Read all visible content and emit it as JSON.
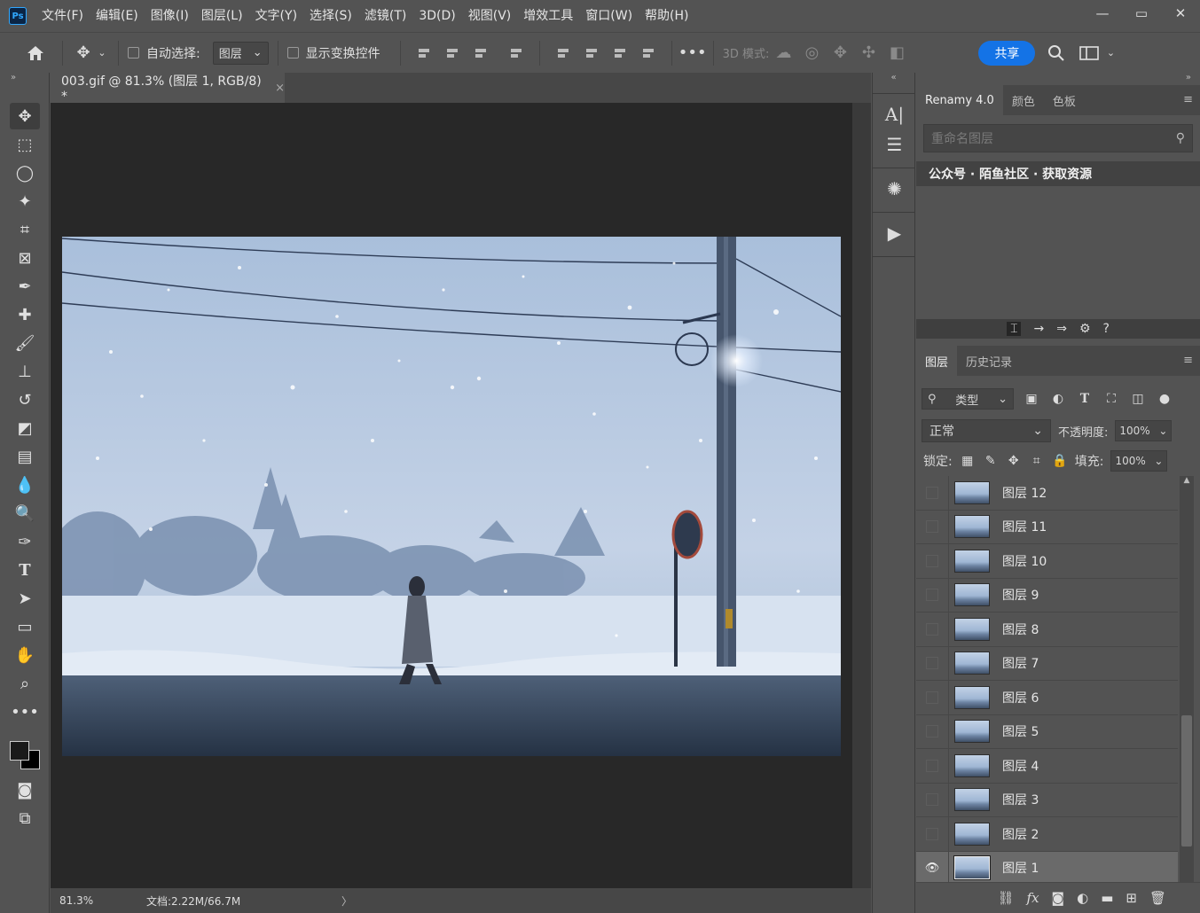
{
  "menu": {
    "logo": "Ps",
    "items": [
      "文件(F)",
      "编辑(E)",
      "图像(I)",
      "图层(L)",
      "文字(Y)",
      "选择(S)",
      "滤镜(T)",
      "3D(D)",
      "视图(V)",
      "增效工具",
      "窗口(W)",
      "帮助(H)"
    ]
  },
  "options": {
    "auto_select_label": "自动选择:",
    "auto_select_target": "图层",
    "show_transform_label": "显示变换控件",
    "mode3d_label": "3D 模式:",
    "share_label": "共享"
  },
  "document": {
    "tab_title": "003.gif @ 81.3% (图层 1, RGB/8) *",
    "close": "×"
  },
  "status": {
    "zoom": "81.3%",
    "doc_info": "文档:2.22M/66.7M",
    "arrow": "〉"
  },
  "renamy": {
    "tabs": [
      "Renamy 4.0",
      "颜色",
      "色板"
    ],
    "search_placeholder": "重命名图层",
    "banner": "公众号 · 陌鱼社区 · 获取资源"
  },
  "layers_panel": {
    "tabs": [
      "图层",
      "历史记录"
    ],
    "filter_label": "类型",
    "blend_mode": "正常",
    "opacity_label": "不透明度:",
    "opacity_value": "100%",
    "lock_label": "锁定:",
    "fill_label": "填充:",
    "fill_value": "100%",
    "layers": [
      {
        "name": "图层 12",
        "visible": false,
        "selected": false
      },
      {
        "name": "图层 11",
        "visible": false,
        "selected": false
      },
      {
        "name": "图层 10",
        "visible": false,
        "selected": false
      },
      {
        "name": "图层 9",
        "visible": false,
        "selected": false
      },
      {
        "name": "图层 8",
        "visible": false,
        "selected": false
      },
      {
        "name": "图层 7",
        "visible": false,
        "selected": false
      },
      {
        "name": "图层 6",
        "visible": false,
        "selected": false
      },
      {
        "name": "图层 5",
        "visible": false,
        "selected": false
      },
      {
        "name": "图层 4",
        "visible": false,
        "selected": false
      },
      {
        "name": "图层 3",
        "visible": false,
        "selected": false
      },
      {
        "name": "图层 2",
        "visible": false,
        "selected": false
      },
      {
        "name": "图层 1",
        "visible": true,
        "selected": true
      }
    ]
  },
  "colors": {
    "accent": "#1473e6",
    "canvas_bg": "#282828",
    "panel_bg": "#535353"
  }
}
